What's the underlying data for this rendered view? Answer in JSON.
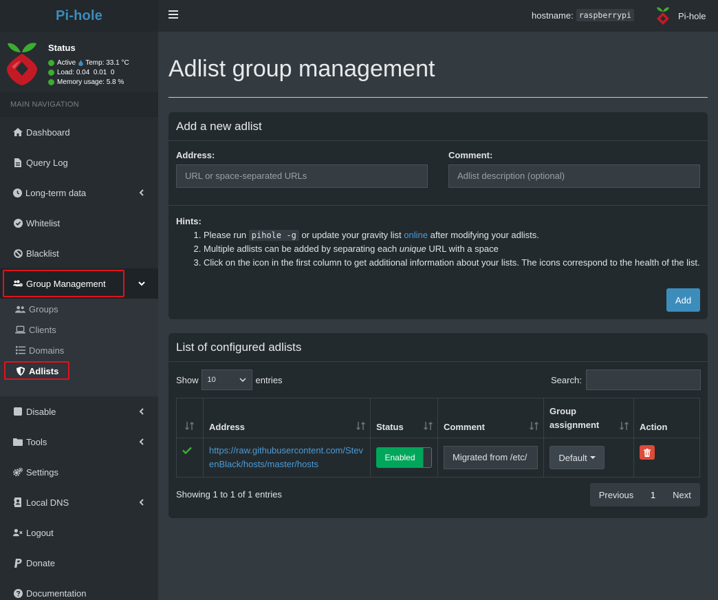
{
  "brand": {
    "name": "Pi-hole"
  },
  "topbar": {
    "hostname_label": "hostname:",
    "hostname_value": "raspberrypi",
    "user_label": "Pi-hole"
  },
  "status": {
    "title": "Status",
    "active": "Active",
    "temp": "Temp: 33.1 °C",
    "load_label": "Load:",
    "load_values": "0.04  0.01  0",
    "memory_label": "Memory usage:",
    "memory_value": "5.8 %"
  },
  "sidebar": {
    "header": "MAIN NAVIGATION",
    "items": [
      {
        "label": "Dashboard",
        "icon": "home-icon"
      },
      {
        "label": "Query Log",
        "icon": "file-icon"
      },
      {
        "label": "Long-term data",
        "icon": "clock-icon"
      },
      {
        "label": "Whitelist",
        "icon": "check-circle-icon"
      },
      {
        "label": "Blacklist",
        "icon": "ban-icon"
      },
      {
        "label": "Group Management",
        "icon": "users-cog-icon"
      },
      {
        "label": "Disable",
        "icon": "stop-icon"
      },
      {
        "label": "Tools",
        "icon": "folder-icon"
      },
      {
        "label": "Settings",
        "icon": "cogs-icon"
      },
      {
        "label": "Local DNS",
        "icon": "address-book-icon"
      },
      {
        "label": "Logout",
        "icon": "user-times-icon"
      },
      {
        "label": "Donate",
        "icon": "paypal-icon"
      },
      {
        "label": "Documentation",
        "icon": "question-circle-icon"
      }
    ],
    "submenu": [
      {
        "label": "Groups",
        "icon": "user-friends-icon"
      },
      {
        "label": "Clients",
        "icon": "laptop-icon"
      },
      {
        "label": "Domains",
        "icon": "list-icon"
      },
      {
        "label": "Adlists",
        "icon": "shield-icon"
      }
    ]
  },
  "page": {
    "title": "Adlist group management"
  },
  "add_box": {
    "title": "Add a new adlist",
    "address_label": "Address:",
    "address_placeholder": "URL or space-separated URLs",
    "comment_label": "Comment:",
    "comment_placeholder": "Adlist description (optional)",
    "hints_title": "Hints:",
    "hint1_pre": "Please run",
    "hint1_code": "pihole -g",
    "hint1_mid": "or update your gravity list",
    "hint1_link": "online",
    "hint1_post": "after modifying your adlists.",
    "hint2_pre": "Multiple adlists can be added by separating each",
    "hint2_em": "unique",
    "hint2_post": "URL with a space",
    "hint3": "Click on the icon in the first column to get additional information about your lists. The icons correspond to the health of the list.",
    "add_button": "Add"
  },
  "list_box": {
    "title": "List of configured adlists",
    "show_label": "Show",
    "entries_value": "10",
    "entries_label": "entries",
    "search_label": "Search:",
    "columns": [
      "Address",
      "Status",
      "Comment",
      "Group assignment",
      "Action"
    ],
    "rows": [
      {
        "address": "https://raw.githubusercontent.com/StevenBlack/hosts/master/hosts",
        "status": "Enabled",
        "comment": "Migrated from /etc/",
        "group": "Default"
      }
    ],
    "showing": "Showing 1 to 1 of 1 entries",
    "pager": {
      "previous": "Previous",
      "page": "1",
      "next": "Next"
    }
  },
  "colors": {
    "accent": "#3c8dbc",
    "success": "#00a65a",
    "danger": "#dd4b39",
    "highlight": "#e2121b"
  }
}
